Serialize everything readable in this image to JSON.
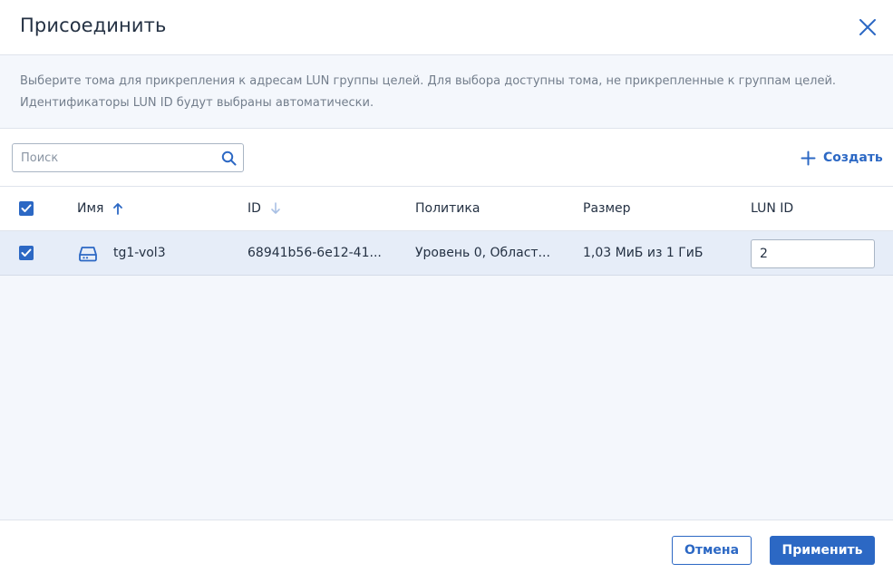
{
  "dialog": {
    "title": "Присоединить",
    "close_icon": "close-icon",
    "info_text": "Выберите тома для прикрепления к адресам LUN группы целей. Для выбора доступны тома, не прикрепленные к группам целей. Идентификаторы LUN ID будут выбраны автоматически."
  },
  "toolbar": {
    "search_placeholder": "Поиск",
    "search_icon": "search-icon",
    "create_label": "Создать",
    "create_icon": "plus-icon"
  },
  "table": {
    "columns": [
      {
        "label": "Имя",
        "sort": "asc"
      },
      {
        "label": "ID",
        "sort": "desc-inactive"
      },
      {
        "label": "Политика"
      },
      {
        "label": "Размер"
      },
      {
        "label": "LUN ID"
      }
    ],
    "header_checkbox_checked": true,
    "rows": [
      {
        "checked": true,
        "icon": "volume-icon",
        "name": "tg1-vol3",
        "id": "68941b56-6e12-41...",
        "policy": "Уровень 0, Област...",
        "size": "1,03 МиБ из 1 ГиБ",
        "lun_id": "2"
      }
    ]
  },
  "footer": {
    "cancel_label": "Отмена",
    "apply_label": "Применить"
  },
  "colors": {
    "accent": "#2c68c4",
    "text": "#243143",
    "muted_text": "#737e8c",
    "panel_bg": "#f4f7fc",
    "selected_row_bg": "#e6edf8",
    "border": "#dfe4ec"
  }
}
